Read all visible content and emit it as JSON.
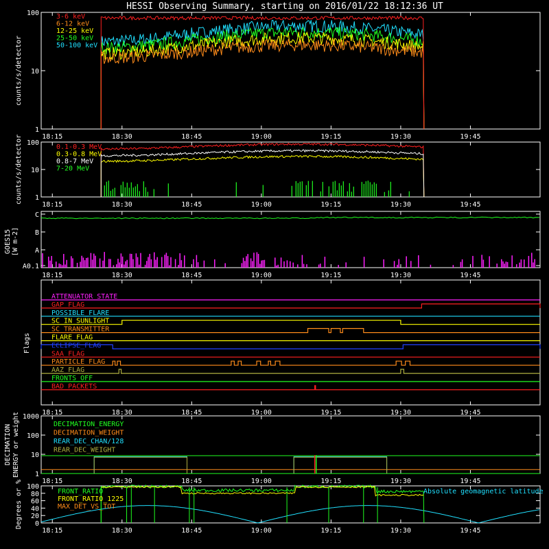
{
  "title": "HESSI Observing Summary, starting on 2016/01/22 18:12:36 UT",
  "x_tick_labels": [
    "18:15",
    "18:30",
    "18:45",
    "19:00",
    "19:15",
    "19:30",
    "19:45"
  ],
  "colors": {
    "red": "#ff2020",
    "orange": "#ff8c1a",
    "yellow": "#ffff00",
    "green": "#20ff20",
    "cyan": "#20e0ff",
    "magenta": "#ff20ff",
    "blue": "#2040ff",
    "olive": "#b0b040",
    "white": "#ffffff"
  },
  "chart_data": [
    {
      "id": "p1",
      "type": "line",
      "ylabel": "counts/s/detector",
      "yscale": "log",
      "ylim": [
        1,
        100
      ],
      "ytick_labels": [
        "1",
        "10",
        "100"
      ],
      "xlim": [
        "18:12:36",
        "20:00:00"
      ],
      "data_interval": [
        "18:25:30",
        "19:35:00"
      ],
      "series": [
        {
          "name": "3-6 keV",
          "color": "#ff2020",
          "approx_level": 80
        },
        {
          "name": "6-12 keV",
          "color": "#ff8c1a",
          "approx_level": 22
        },
        {
          "name": "12-25 keV",
          "color": "#ffff00",
          "approx_level": 28
        },
        {
          "name": "25-50 keV",
          "color": "#20ff20",
          "approx_level": 35
        },
        {
          "name": "50-100 keV",
          "color": "#20e0ff",
          "approx_level": 45
        }
      ]
    },
    {
      "id": "p2",
      "type": "line",
      "ylabel": "counts/s/detector",
      "yscale": "log",
      "ylim": [
        1,
        100
      ],
      "ytick_labels": [
        "1",
        "10",
        "100"
      ],
      "data_interval": [
        "18:25:30",
        "19:35:00"
      ],
      "series": [
        {
          "name": "0.1-0.3 MeV",
          "color": "#ff2020",
          "approx_level": 70
        },
        {
          "name": "0.3-0.8 MeV",
          "color": "#ffff00",
          "approx_level": 40
        },
        {
          "name": "0.8-7 MeV",
          "color": "#ffffff",
          "approx_level": 45
        },
        {
          "name": "7-20 MeV",
          "color": "#20ff20",
          "approx_level": 1.5
        }
      ]
    },
    {
      "id": "p3",
      "type": "line",
      "ylabel": "GOES15",
      "ylabel2": "[W m-2]",
      "ytick_labels": [
        "A0.1",
        "A",
        "B",
        "C"
      ],
      "series": [
        {
          "name": "GOES long",
          "color": "#20ff20",
          "approx_class": "B9"
        },
        {
          "name": "GOES short",
          "color": "#ff20ff",
          "approx_class": "A0.1-A0.3"
        }
      ]
    },
    {
      "id": "p4",
      "type": "line",
      "ylabel": "Flags",
      "flags": [
        {
          "name": "ATTENUATOR_STATE",
          "color": "#ff20ff"
        },
        {
          "name": "GAP_FLAG",
          "color": "#ff2020"
        },
        {
          "name": "POSSIBLE_FLARE",
          "color": "#20e0ff"
        },
        {
          "name": "SC_IN_SUNLIGHT",
          "color": "#ffff00"
        },
        {
          "name": "SC_TRANSMITTER",
          "color": "#ff8c1a"
        },
        {
          "name": "FLARE_FLAG",
          "color": "#ffff00"
        },
        {
          "name": "ECLIPSE_FLAG",
          "color": "#2040ff"
        },
        {
          "name": "SAA_FLAG",
          "color": "#ff2020"
        },
        {
          "name": "PARTICLE_FLAG",
          "color": "#ff8c1a"
        },
        {
          "name": "AAZ_FLAG",
          "color": "#b0b040"
        },
        {
          "name": "FRONTS_OFF",
          "color": "#20ff20"
        },
        {
          "name": "BAD_PACKETS",
          "color": "#ff2020"
        }
      ]
    },
    {
      "id": "p5",
      "type": "line",
      "ylabel": "DECIMATION",
      "ylabel2": "ENERGY or weight",
      "yscale": "log",
      "ylim": [
        1,
        1000
      ],
      "ytick_labels": [
        "1",
        "10",
        "100",
        "1000"
      ],
      "series": [
        {
          "name": "DECIMATION_ENERGY",
          "color": "#20ff20"
        },
        {
          "name": "DECIMATION_WEIGHT",
          "color": "#ff8c1a"
        },
        {
          "name": "REAR_DEC_CHAN/128",
          "color": "#20e0ff"
        },
        {
          "name": "REAR_DEC_WEIGHT",
          "color": "#b0b040"
        }
      ]
    },
    {
      "id": "p6",
      "type": "line",
      "ylabel": "Degrees or %",
      "ylim": [
        0,
        100
      ],
      "ytick_labels": [
        "0",
        "20",
        "40",
        "60",
        "80",
        "100"
      ],
      "series": [
        {
          "name": "FRONT_RATIO",
          "color": "#20ff20"
        },
        {
          "name": "FRONT_RATIO_1225",
          "color": "#ffff00"
        },
        {
          "name": "MAX_DET_VS_TOT",
          "color": "#ff8c1a"
        },
        {
          "name": "Absolute geomagnetic latitude",
          "color": "#20e0ff"
        }
      ]
    }
  ]
}
